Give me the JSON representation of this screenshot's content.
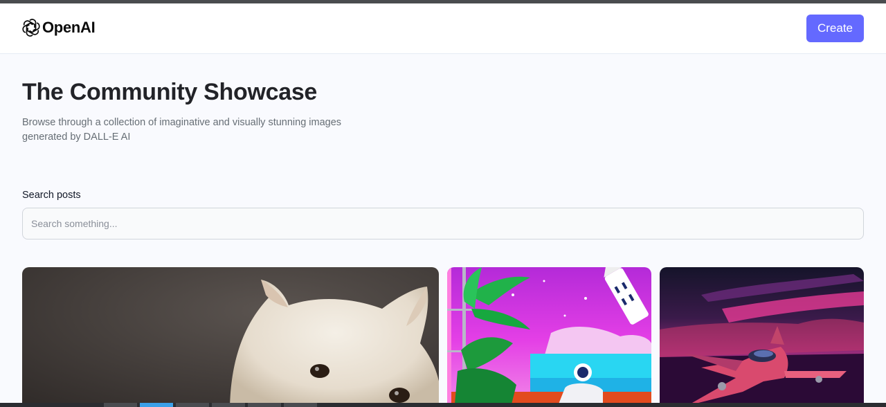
{
  "header": {
    "brand": "OpenAI",
    "create_label": "Create",
    "logo_icon": "openai-logo-icon",
    "accent": "#6469ff"
  },
  "hero": {
    "title": "The Community Showcase",
    "subtitle": "Browse through a collection of imaginative and visually stunning images generated by DALL-E AI"
  },
  "search": {
    "label": "Search posts",
    "placeholder": "Search something...",
    "value": ""
  },
  "gallery": {
    "cards": [
      {
        "subject": "white dog"
      },
      {
        "subject": "astronaut with rocket and palm tree"
      },
      {
        "subject": "fighter jet in purple sky"
      }
    ]
  }
}
